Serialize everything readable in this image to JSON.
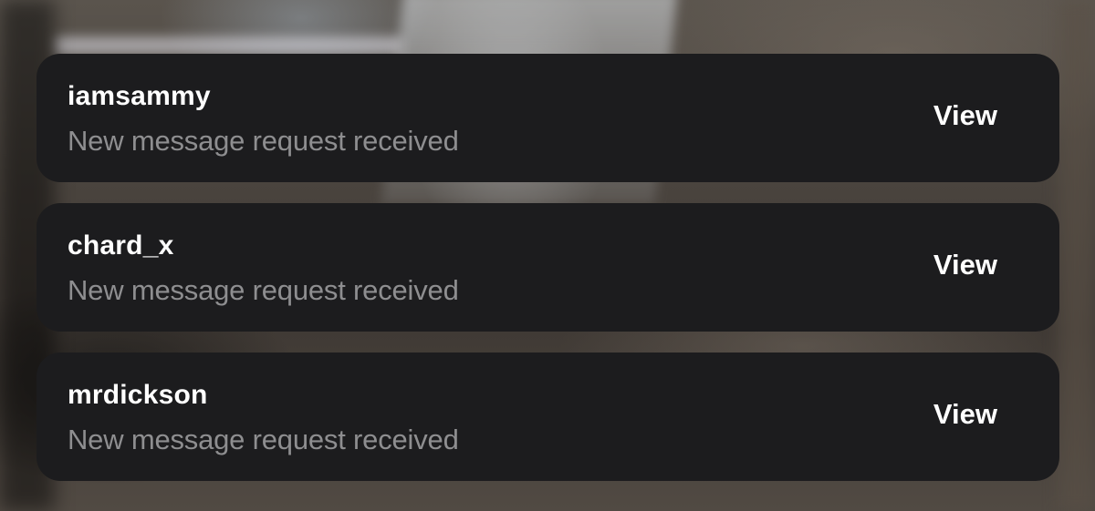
{
  "notifications": [
    {
      "username": "iamsammy",
      "message": "New message request received",
      "action": "View"
    },
    {
      "username": "chard_x",
      "message": "New message request received",
      "action": "View"
    },
    {
      "username": "mrdickson",
      "message": "New message request received",
      "action": "View"
    }
  ]
}
